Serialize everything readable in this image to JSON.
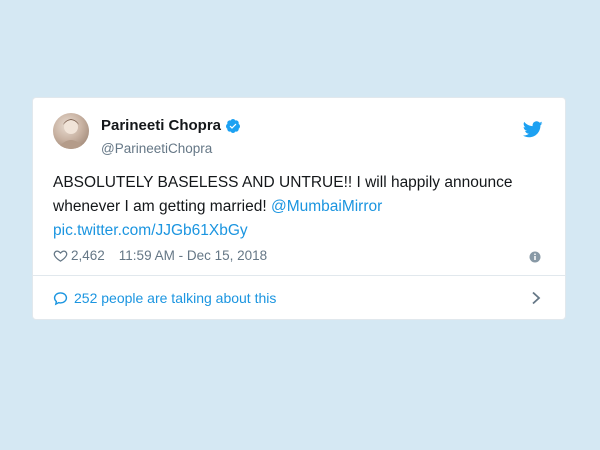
{
  "tweet": {
    "author_name": "Parineeti Chopra",
    "author_handle": "@ParineetiChopra",
    "text_main": "ABSOLUTELY BASELESS AND UNTRUE!! I will happily announce whenever I am getting married! ",
    "mention": "@MumbaiMirror",
    "link": "pic.twitter.com/JJGb61XbGy",
    "likes": "2,462",
    "timestamp": "11:59 AM - Dec 15, 2018",
    "talking": "252 people are talking about this"
  },
  "colors": {
    "background": "#d5e8f3",
    "link": "#1b95e0",
    "text": "#14171a",
    "muted": "#657786",
    "verified": "#1da1f2"
  },
  "icons": [
    "verified-badge-icon",
    "twitter-bird-icon",
    "heart-icon",
    "info-icon",
    "speech-bubble-icon",
    "chevron-right-icon"
  ]
}
